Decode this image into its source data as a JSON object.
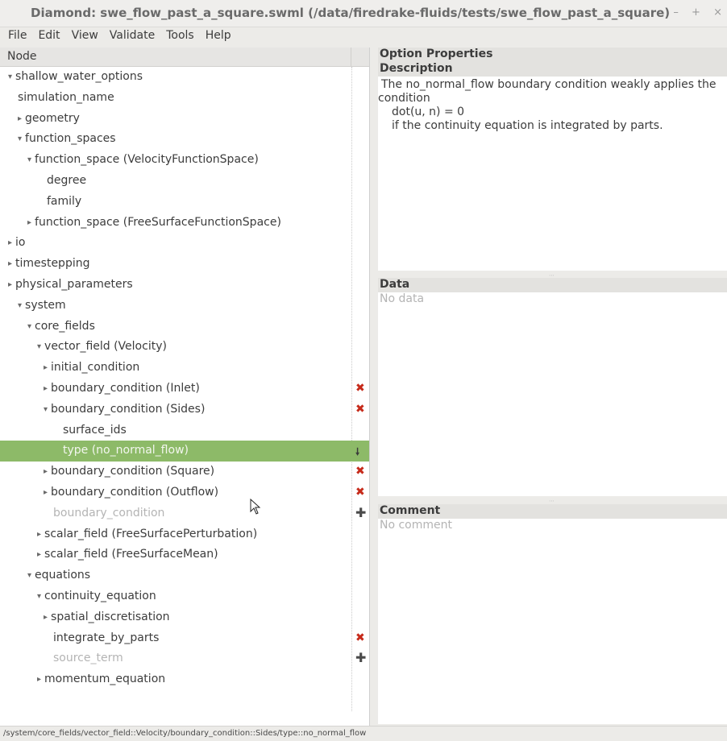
{
  "window": {
    "title": "Diamond: swe_flow_past_a_square.swml (/data/firedrake-fluids/tests/swe_flow_past_a_square)",
    "minimize": "–",
    "maximize": "+",
    "close": "×"
  },
  "menu": [
    "File",
    "Edit",
    "View",
    "Validate",
    "Tools",
    "Help"
  ],
  "tree": {
    "header": "Node",
    "rows": [
      {
        "label": "shallow_water_options",
        "arrow": "▾"
      },
      {
        "label": "simulation_name",
        "arrow": ""
      },
      {
        "label": "geometry",
        "arrow": "▸"
      },
      {
        "label": "function_spaces",
        "arrow": "▾"
      },
      {
        "label": "function_space (VelocityFunctionSpace)",
        "arrow": "▾"
      },
      {
        "label": "degree",
        "arrow": ""
      },
      {
        "label": "family",
        "arrow": ""
      },
      {
        "label": "function_space (FreeSurfaceFunctionSpace)",
        "arrow": "▸"
      },
      {
        "label": "io",
        "arrow": "▸"
      },
      {
        "label": "timestepping",
        "arrow": "▸"
      },
      {
        "label": "physical_parameters",
        "arrow": "▸"
      },
      {
        "label": "system",
        "arrow": "▾"
      },
      {
        "label": "core_fields",
        "arrow": "▾"
      },
      {
        "label": "vector_field (Velocity)",
        "arrow": "▾"
      },
      {
        "label": "initial_condition",
        "arrow": "▸"
      },
      {
        "label": "boundary_condition (Inlet)",
        "arrow": "▸"
      },
      {
        "label": "boundary_condition (Sides)",
        "arrow": "▾"
      },
      {
        "label": "surface_ids",
        "arrow": ""
      },
      {
        "label": "type (no_normal_flow)",
        "arrow": ""
      },
      {
        "label": "boundary_condition (Square)",
        "arrow": "▸"
      },
      {
        "label": "boundary_condition (Outflow)",
        "arrow": "▸"
      },
      {
        "label": "boundary_condition",
        "arrow": ""
      },
      {
        "label": "scalar_field (FreeSurfacePerturbation)",
        "arrow": "▸"
      },
      {
        "label": "scalar_field (FreeSurfaceMean)",
        "arrow": "▸"
      },
      {
        "label": "equations",
        "arrow": "▾"
      },
      {
        "label": "continuity_equation",
        "arrow": "▾"
      },
      {
        "label": "spatial_discretisation",
        "arrow": "▸"
      },
      {
        "label": "integrate_by_parts",
        "arrow": ""
      },
      {
        "label": "source_term",
        "arrow": ""
      },
      {
        "label": "momentum_equation",
        "arrow": "▸"
      }
    ],
    "marks": {
      "remove": "✖",
      "add": "✚",
      "choose": "🠗"
    }
  },
  "option_properties": {
    "title": "Option Properties",
    "description_header": "Description",
    "description_lines": [
      "The no_normal_flow boundary condition weakly applies the",
      "condition",
      "dot(u, n) = 0",
      "if the continuity equation is integrated by parts."
    ],
    "data_header": "Data",
    "data_placeholder": "No data",
    "comment_header": "Comment",
    "comment_placeholder": "No comment"
  },
  "status_path": "/system/core_fields/vector_field::Velocity/boundary_condition::Sides/type::no_normal_flow",
  "colors": {
    "selection": "#8dba68",
    "remove_mark": "#c62a1a"
  }
}
